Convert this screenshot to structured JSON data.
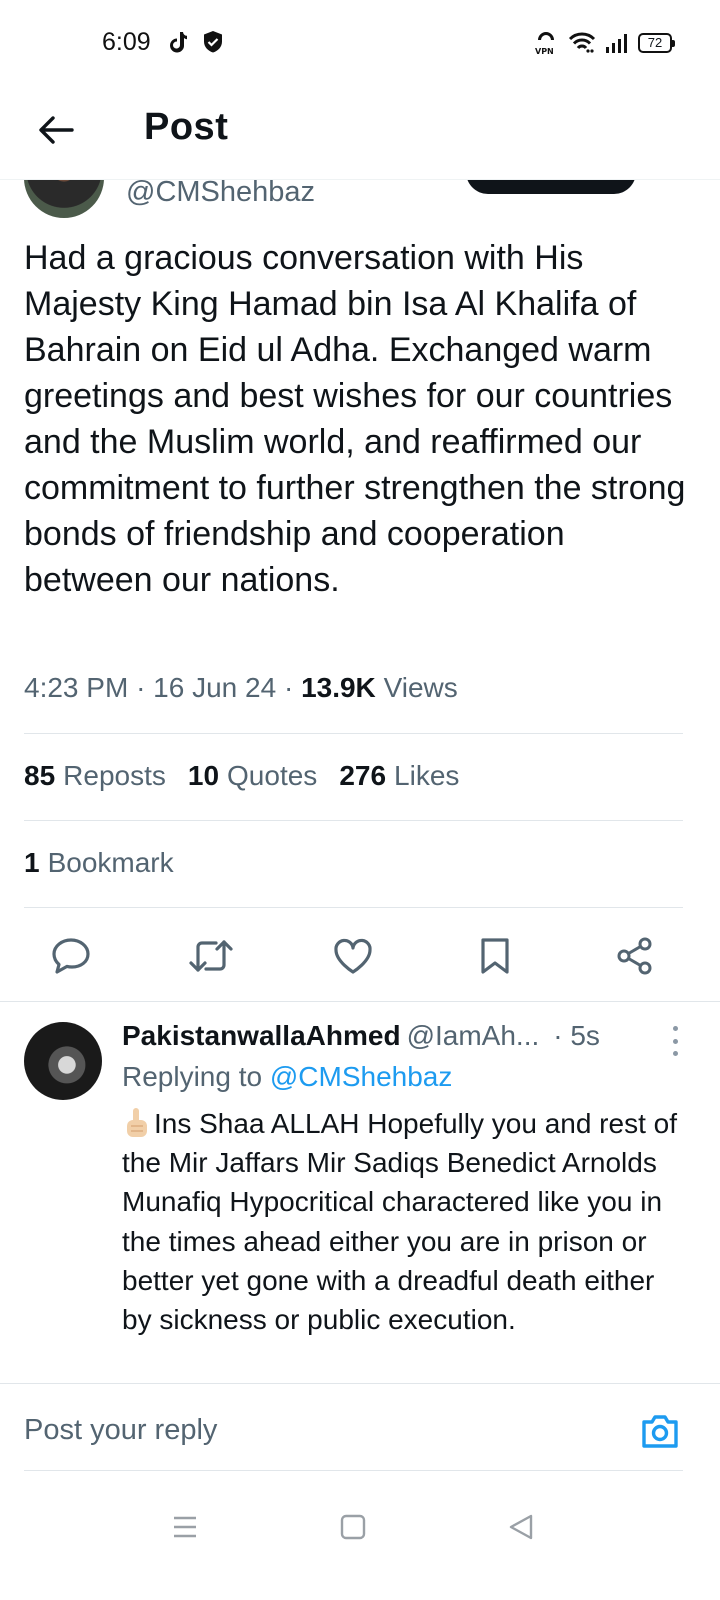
{
  "status_bar": {
    "time": "6:09",
    "battery": "72"
  },
  "header": {
    "title": "Post"
  },
  "author": {
    "handle": "@CMShehbaz"
  },
  "tweet": {
    "text": "Had a gracious conversation with His Majesty King Hamad bin Isa Al Khalifa of Bahrain on Eid ul Adha. Exchanged warm greetings and best wishes for our countries and the Muslim world, and reaffirmed our commitment to further strengthen the strong bonds of friendship and cooperation between our nations.",
    "time": "4:23 PM",
    "date": "16 Jun 24",
    "separator": "·",
    "views_count": "13.9K",
    "views_label": "Views"
  },
  "stats": {
    "reposts_count": "85",
    "reposts_label": "Reposts",
    "quotes_count": "10",
    "quotes_label": "Quotes",
    "likes_count": "276",
    "likes_label": "Likes",
    "bookmarks_count": "1",
    "bookmarks_label": "Bookmark"
  },
  "reply": {
    "name": "PakistanwallaAhmed",
    "handle": "@IamAh...",
    "time": "· 5s",
    "replying_prefix": "Replying to",
    "replying_to": "@CMShehbaz",
    "text": "Ins Shaa ALLAH Hopefully you and rest of the Mir Jaffars Mir Sadiqs Benedict Arnolds Munafiq Hypocritical charactered like you in the times ahead either you are in prison or better yet gone with a dreadful death either by sickness or public execution."
  },
  "composer": {
    "placeholder": "Post your reply"
  },
  "colors": {
    "accent": "#1d9bf0",
    "text_primary": "#0f1419",
    "text_secondary": "#536471",
    "divider": "#e1e6ea"
  },
  "icons": [
    "back-arrow-icon",
    "reply-icon",
    "repost-icon",
    "like-icon",
    "bookmark-icon",
    "share-icon",
    "camera-icon",
    "more-icon"
  ]
}
